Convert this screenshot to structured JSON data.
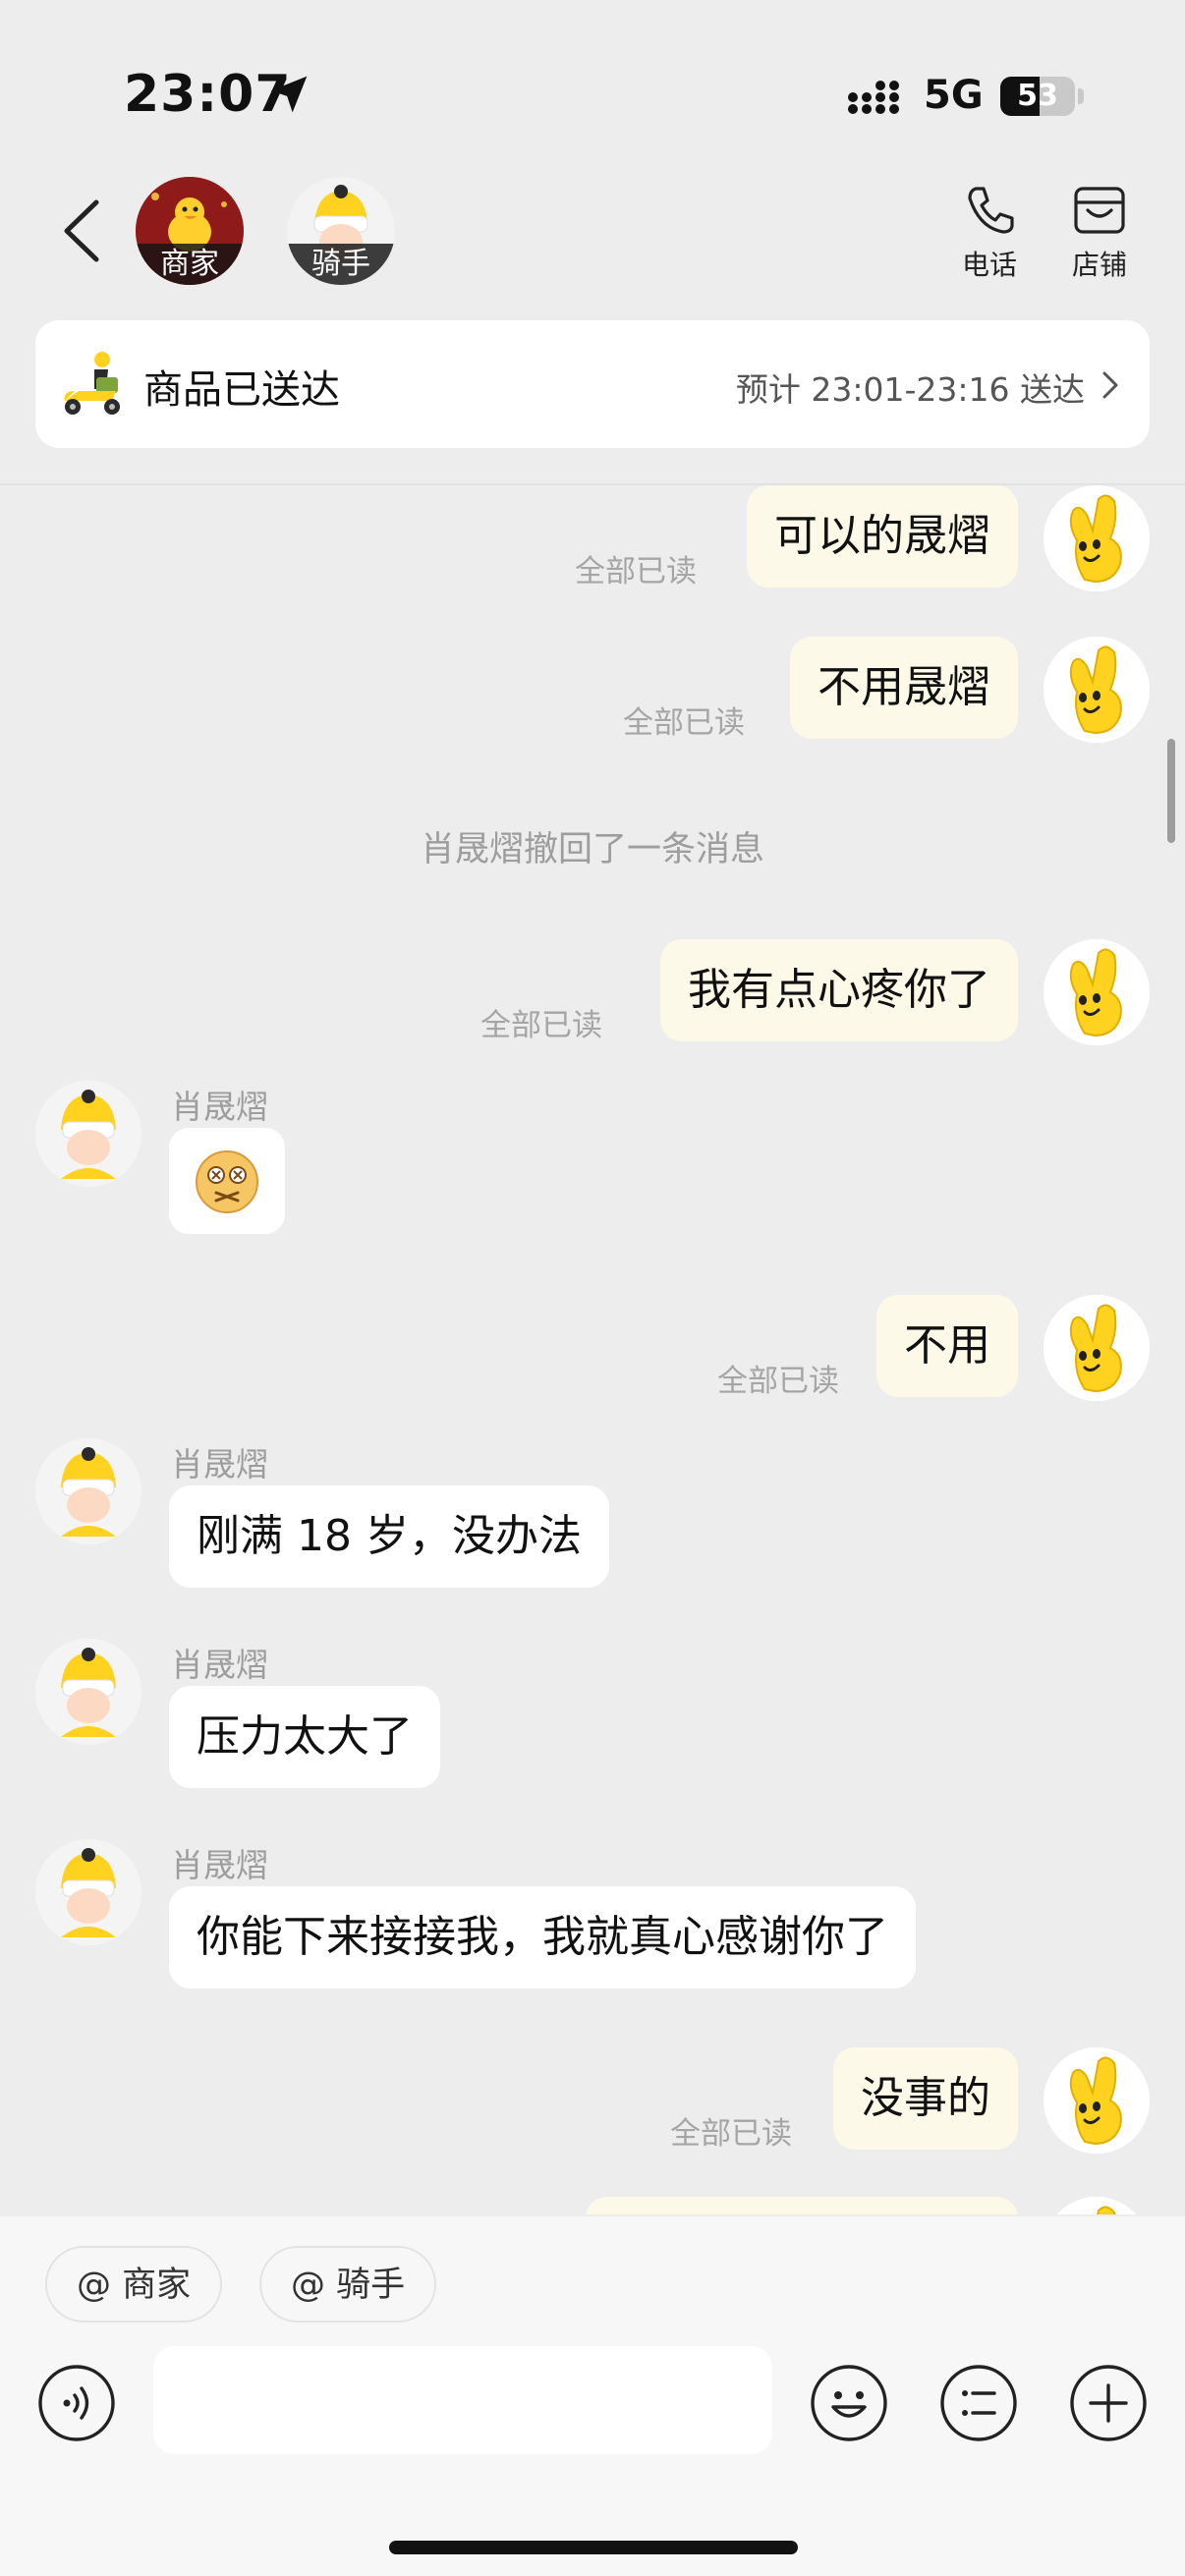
{
  "status_bar": {
    "time": "23:07",
    "network": "5G",
    "battery": "53",
    "battery_level": 0.53
  },
  "header": {
    "merchant_tag": "商家",
    "rider_tag": "骑手",
    "phone_label": "电话",
    "store_label": "店铺"
  },
  "delivery": {
    "status": "商品已送达",
    "eta": "预计 23:01-23:16 送达"
  },
  "messages": [
    {
      "dir": "out",
      "text": "可以的晟熠",
      "read": "全部已读"
    },
    {
      "dir": "out",
      "text": "不用晟熠",
      "read": "全部已读"
    },
    {
      "dir": "system",
      "text": "肖晟熠撤回了一条消息"
    },
    {
      "dir": "out",
      "text": "我有点心疼你了",
      "read": "全部已读"
    },
    {
      "dir": "in",
      "sender": "肖晟熠",
      "emoji": "dizzy-face-emoji"
    },
    {
      "dir": "out",
      "text": "不用",
      "read": "全部已读"
    },
    {
      "dir": "in",
      "sender": "肖晟熠",
      "text": "刚满 18 岁，没办法"
    },
    {
      "dir": "in",
      "sender": "肖晟熠",
      "text": "压力太大了"
    },
    {
      "dir": "in",
      "sender": "肖晟熠",
      "text": "你能下来接接我，我就真心感谢你了"
    },
    {
      "dir": "out",
      "text": "没事的",
      "read": "全部已读"
    }
  ],
  "composer": {
    "mention_merchant": "@ 商家",
    "mention_rider": "@ 骑手",
    "input_value": "",
    "icons": [
      "voice-icon",
      "emoji-icon",
      "quick-reply-icon",
      "plus-icon"
    ]
  },
  "colors": {
    "accent_yellow": "#ffd21f",
    "outgoing_bubble": "#fdf9e8",
    "incoming_bubble": "#ffffff",
    "background": "#ededed"
  }
}
